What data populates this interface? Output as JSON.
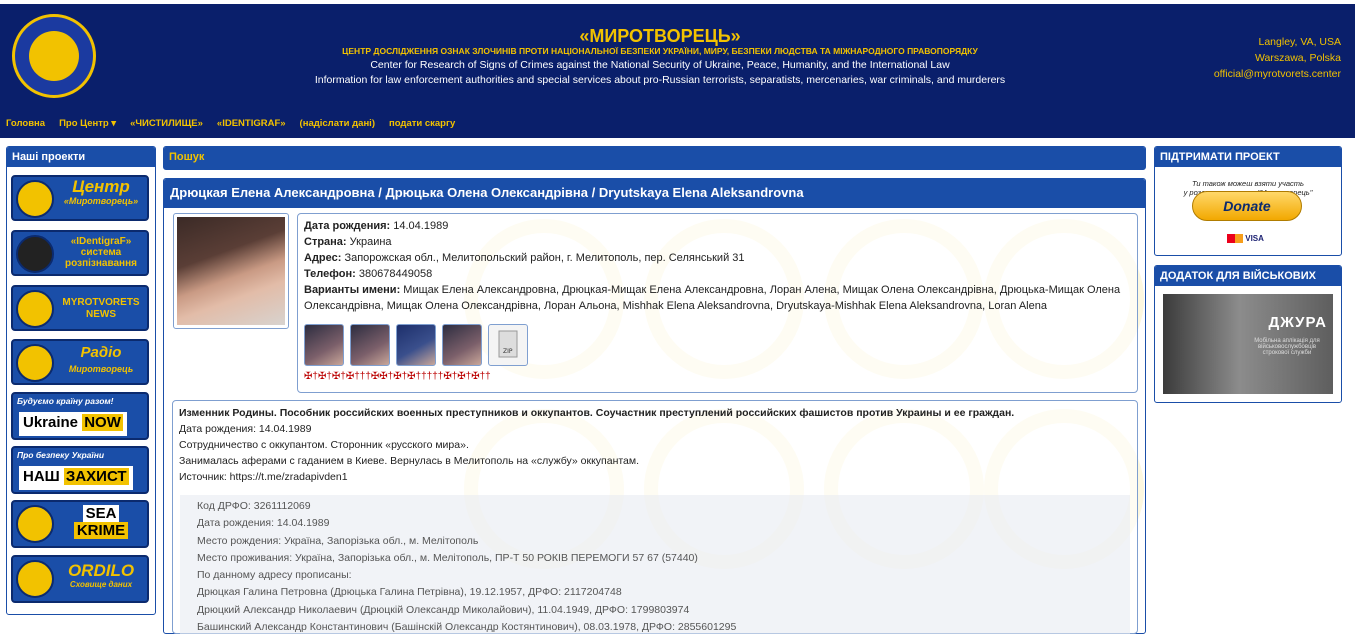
{
  "header": {
    "title": "«МИРОТВОРЕЦЬ»",
    "subtitle": "ЦЕНТР ДОСЛІДЖЕННЯ ОЗНАК ЗЛОЧИНІВ ПРОТИ НАЦІОНАЛЬНОЇ БЕЗПЕКИ УКРАЇНИ, МИРУ, БЕЗПЕКИ ЛЮДСТВА ТА МІЖНАРОДНОГО ПРАВОПОРЯДКУ",
    "en_line1": "Center for Research of Signs of Crimes against the National Security of Ukraine, Peace, Humanity, and the International Law",
    "en_line2": "Information for law enforcement authorities and special services about pro-Russian terrorists, separatists, mercenaries, war criminals, and murderers",
    "right_line1": "Langley, VA, USA",
    "right_line2": "Warszawa, Polska",
    "right_line3": "official@myrotvorets.center"
  },
  "nav": {
    "home": "Головна",
    "about": "Про Центр ▾",
    "purgatory": "«ЧИСТИЛИЩЕ»",
    "identigraf": "«IDENTIGRAF»",
    "send_data": "(надіслати дані)",
    "complaint": "подати скаргу"
  },
  "left": {
    "heading": "Наші проекти",
    "projects": [
      {
        "line1": "Центр",
        "line2": "«Миротворець»"
      },
      {
        "line1": "«IDentigraF»",
        "line2": "система",
        "line3": "розпізнавання"
      },
      {
        "line1": "MYROTVORETS",
        "line2": "NEWS"
      },
      {
        "line1": "Радіо",
        "line2": "Миротворець"
      }
    ],
    "ukraine_now_top": "Будуємо країну разом!",
    "ukraine_now_a": "Ukraine",
    "ukraine_now_b": "NOW",
    "nash_top": "Про безпеку України",
    "nash_a": "НАШ",
    "nash_b": "ЗАХИСТ",
    "sea_a": "SEA",
    "sea_b": "KRIME",
    "ordilo_a": "ORDILO",
    "ordilo_b": "Сховище даних"
  },
  "search": {
    "label": "Пошук"
  },
  "profile": {
    "title": "Дрюцкая Елена Александровна / Дрюцька Олена Олександрівна / Dryutskaya Elena Aleksandrovna",
    "birth_label": "Дата рождения:",
    "birth": "14.04.1989",
    "country_label": "Страна:",
    "country": "Украина",
    "address_label": "Адрес:",
    "address": "Запорожская обл., Мелитопольский район, г. Мелитополь, пер. Селянський 31",
    "phone_label": "Телефон:",
    "phone": "380678449058",
    "variants_label": "Варианты имени:",
    "variants": "Мищак Елена Александровна, Дрюцкая-Мищак Елена Александровна, Лоран Алена, Мищак Олена Олександрівна, Дрюцька-Мищак Олена Олександрівна, Мищак Олена Олександрівна, Лоран Альона, Mishhak Elena Aleksandrovna, Dryutskaya-Mishhak Elena Aleksandrovna, Loran Alena",
    "crosses": "✠†✠†✠†✠†††✠✠†✠†✠†††††✠†✠†✠††"
  },
  "description": {
    "headline": "Изменник Родины. Пособник российских военных преступников и оккупантов. Соучастник преступлений российских фашистов против Украины и ее граждан.",
    "line1": "Дата рождения: 14.04.1989",
    "line2": "Сотрудничество с оккупантом. Сторонник «русского мира».",
    "line3": "Занималась аферами с гаданием в Киеве. Вернулась в Мелитополь на «службу» оккупантам.",
    "line4": "Источник: https://t.me/zradapivden1"
  },
  "quote": [
    "Код ДРФО: 3261112069",
    "Дата рождения: 14.04.1989",
    "Место рождения: Україна, Запорізька обл., м. Мелітополь",
    "Место проживания: Україна, Запорізька обл., м. Мелітополь, ПР-Т 50 РОКІВ ПЕРЕМОГИ 57 67 (57440)",
    "По данному адресу прописаны:",
    "Дрюцкая Галина Петровна (Дрюцька Галина Петрівна), 19.12.1957, ДРФО: 2117204748",
    "Дрюцкий Александр Николаевич (Дрюцкій Олександр Миколайович), 11.04.1949, ДРФО: 1799803974",
    "Башинский Александр Константинович (Башінскій Олександр Костянтинович), 08.03.1978, ДРФО: 2855601295"
  ],
  "right": {
    "support_heading": "ПІДТРИМАТИ ПРОЕКТ",
    "support_text1": "Ти також можеш взяти участь",
    "support_text2": "у розвитку проекта \"Миротворець\"",
    "donate": "Donate",
    "cards": "VISA",
    "military_heading": "ДОДАТОК ДЛЯ ВІЙСЬКОВИХ",
    "app_name": "ДЖУРА",
    "app_desc": "Мобільна аплікація для військовослужбовців строкової служби"
  }
}
